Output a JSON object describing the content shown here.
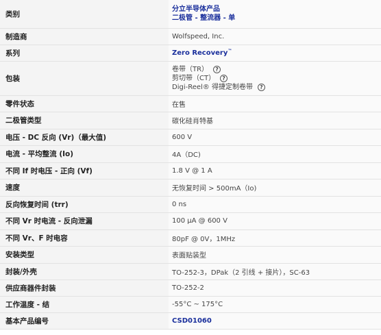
{
  "rows": [
    {
      "label": "类别",
      "lines": [
        "分立半导体产品",
        "二极管 - 整流器 - 单"
      ]
    },
    {
      "label": "制造商",
      "value": "Wolfspeed, Inc."
    },
    {
      "label": "系列",
      "value": "Zero Recovery",
      "trademark": "™"
    },
    {
      "label": "包装",
      "lines": [
        "卷带（TR）",
        "剪切带（CT）",
        "Digi-Reel® 得捷定制卷带"
      ],
      "help_icon": "?"
    },
    {
      "label": "零件状态",
      "value": "在售"
    },
    {
      "label": "二极管类型",
      "value": "碳化硅肖特基"
    },
    {
      "label": "电压 - DC 反向 (Vr)（最大值)",
      "value": "600 V"
    },
    {
      "label": "电流 - 平均整流 (Io)",
      "value": "4A（DC)"
    },
    {
      "label": "不同 If 时电压 - 正向 (Vf)",
      "value": "1.8 V @ 1 A"
    },
    {
      "label": "速度",
      "value": "无恢复时间 > 500mA（Io)"
    },
    {
      "label": "反向恢复时间 (trr)",
      "value": "0 ns"
    },
    {
      "label": "不同 Vr 时电流 - 反向泄漏",
      "value": "100 µA @ 600 V"
    },
    {
      "label": "不同 Vr、F 时电容",
      "value": "80pF @ 0V，1MHz"
    },
    {
      "label": "安装类型",
      "value": "表面贴装型"
    },
    {
      "label": "封装/外壳",
      "value": "TO-252-3，DPak（2 引线 + 接片），SC-63"
    },
    {
      "label": "供应商器件封装",
      "value": "TO-252-2"
    },
    {
      "label": "工作温度 - 结",
      "value": "-55°C ~ 175°C"
    },
    {
      "label": "基本产品编号",
      "value": "CSD01060"
    }
  ]
}
